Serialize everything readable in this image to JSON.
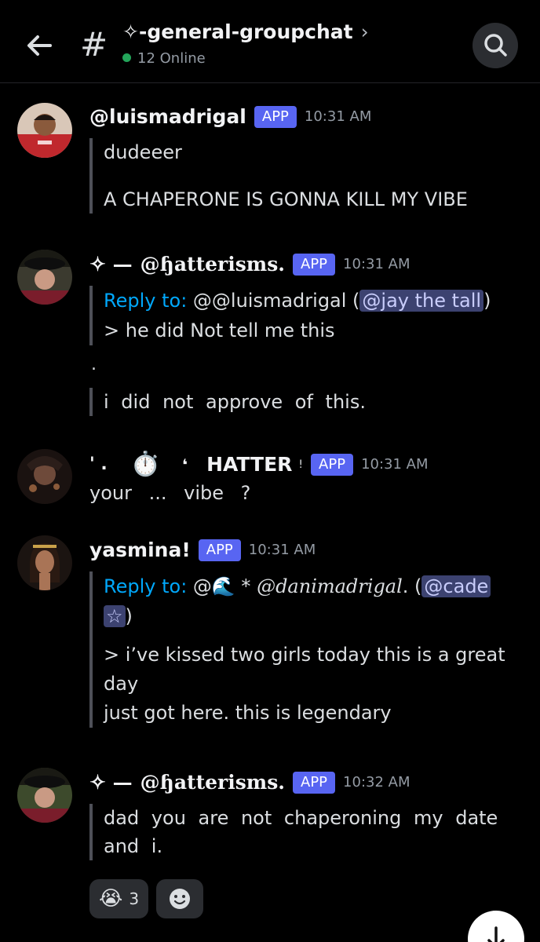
{
  "header": {
    "channel_name": "✧-general-groupchat",
    "chevron": "›",
    "hash": "#",
    "online_text": "12 Online",
    "icons": {
      "back": "arrow-left-icon",
      "search": "search-icon"
    }
  },
  "messages": [
    {
      "username": "@luismadrigal",
      "badge": "APP",
      "time": "10:31 AM",
      "lines": [
        "dudeeer",
        "A CHAPERONE IS GONNA KILL MY VIBE"
      ]
    },
    {
      "prefix": "✧ —",
      "username": "@ɧatterisms.",
      "badge": "APP",
      "time": "10:31 AM",
      "reply_label": "Reply to:",
      "reply_target": " @@luismadrigal (",
      "reply_mention": "@jay the tall",
      "reply_close": ")",
      "quoted": "> he did Not tell me this",
      "dot": ".",
      "line": "i did not approve of this."
    },
    {
      "prefix": "' .",
      "emoji": "⏱️",
      "suffix": "❛",
      "username": "HATTER",
      "name_tail": "!",
      "badge": "APP",
      "time": "10:31 AM",
      "line": "your ... vibe ?"
    },
    {
      "username": "yasmina!",
      "badge": "APP",
      "time": "10:31 AM",
      "reply_label": "Reply to:",
      "reply_target_a": " @🌊 * ",
      "reply_target_b": "@danimadrigal",
      "reply_target_c": ". (",
      "reply_mention_a": "@cade",
      "reply_mention_b": "☆",
      "reply_close": ")",
      "lines": [
        "> i’ve kissed two girls today this is a great",
        "day",
        "just got here. this is legendary"
      ]
    },
    {
      "prefix": "✧ —",
      "username": "@ɧatterisms.",
      "badge": "APP",
      "time": "10:32 AM",
      "lines": [
        "dad you are not chaperoning my date",
        "and i."
      ]
    }
  ],
  "reactions": [
    {
      "emoji": "😭",
      "count": "3"
    },
    {
      "icon": "add-reaction-icon"
    }
  ],
  "colors": {
    "accent": "#5865f2",
    "online": "#23a55a",
    "link": "#00a8fc",
    "background": "#000000"
  }
}
